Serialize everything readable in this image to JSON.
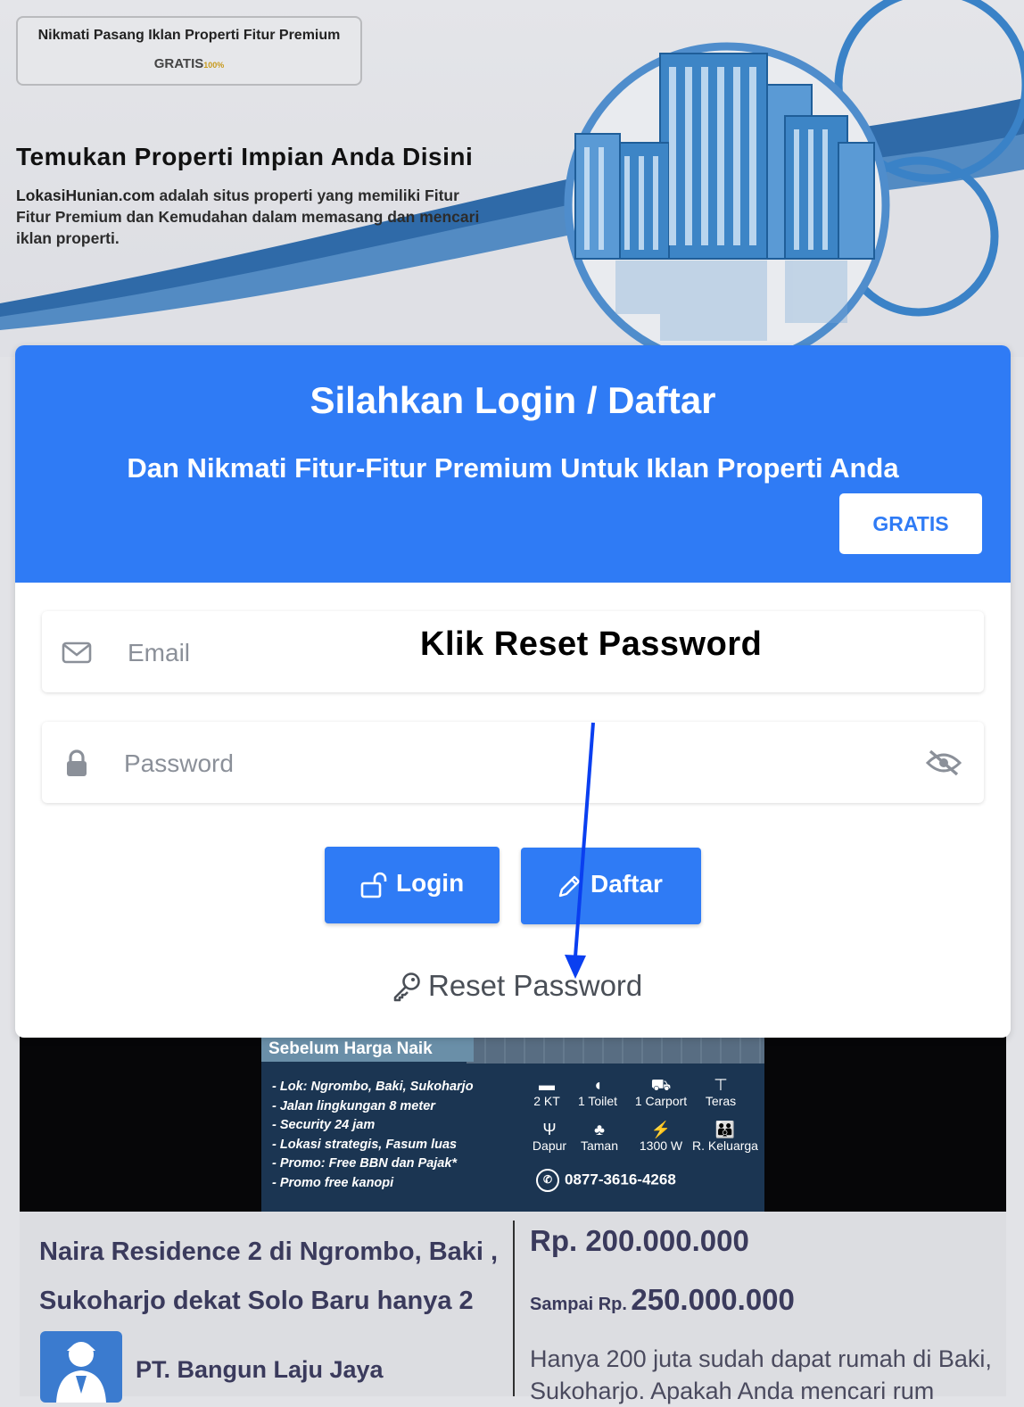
{
  "hero": {
    "promo_line1": "Nikmati Pasang Iklan Properti Fitur Premium",
    "promo_line2": "GRATIS",
    "promo_pct": "100%",
    "title": "Temukan Properti Impian Anda Disini",
    "desc_brand": "LokasiHunian.com",
    "desc_rest": "adalah situs properti yang memiliki Fitur Fitur Premium dan Kemudahan dalam memasang dan mencari iklan properti."
  },
  "card": {
    "title": "Silahkan Login / Daftar",
    "subtitle": "Dan Nikmati Fitur-Fitur Premium Untuk Iklan Properti Anda",
    "gratis_label": "GRATIS",
    "email_placeholder": "Email",
    "password_placeholder": "Password",
    "login_label": "Login",
    "daftar_label": "Daftar",
    "reset_label": "Reset Password"
  },
  "annotation": {
    "text": "Klik Reset Password",
    "arrow_color": "#0a3ff0"
  },
  "listing": {
    "flyer_heading": "Sebelum Harga Naik",
    "features": [
      "- Lok: Ngrombo, Baki, Sukoharjo",
      "- Jalan lingkungan 8 meter",
      "- Security 24 jam",
      "- Lokasi strategis, Fasum luas",
      "- Promo: Free BBN dan Pajak*",
      "- Promo free kanopi"
    ],
    "amenities": [
      "2 KT",
      "1 Toilet",
      "1 Carport",
      "Teras",
      "Dapur",
      "Taman",
      "1300 W",
      "R. Keluarga"
    ],
    "phone": "0877-3616-4268",
    "title": "Naira Residence 2 di Ngrombo, Baki , Sukoharjo dekat Solo Baru hanya 2",
    "agent": "PT. Bangun Laju Jaya",
    "price_from": "Rp. 200.000.000",
    "price_to_label": "Sampai Rp.",
    "price_to": "250.000.000",
    "description": "Hanya 200 juta sudah dapat rumah di Baki, Sukoharjo. Apakah Anda mencari rum"
  },
  "colors": {
    "primary": "#2f7bf5",
    "banner_blue": "#2e6fb4"
  }
}
